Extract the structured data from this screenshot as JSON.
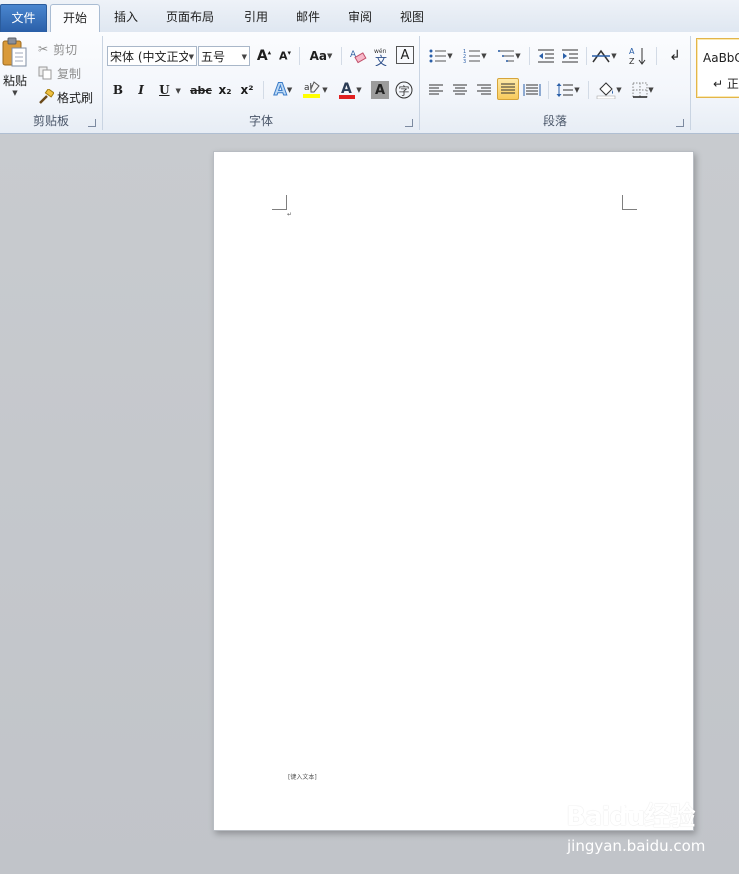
{
  "tabs": {
    "file": "文件",
    "home": "开始",
    "insert": "插入",
    "layout": "页面布局",
    "references": "引用",
    "mailings": "邮件",
    "review": "审阅",
    "view": "视图"
  },
  "clipboard": {
    "paste": "粘贴",
    "cut": "剪切",
    "copy": "复制",
    "format_painter": "格式刷",
    "group_label": "剪贴板"
  },
  "font": {
    "font_name": "宋体 (中文正文",
    "font_size": "五号",
    "change_case": "Aa",
    "bold": "B",
    "italic": "I",
    "underline": "U",
    "strikethrough": "abc",
    "subscript": "x₂",
    "superscript": "x²",
    "group_label": "字体",
    "font_color": "#e02020",
    "highlight_color": "#ffff00"
  },
  "paragraph": {
    "group_label": "段落"
  },
  "styles": {
    "preview": "AaBbC",
    "normal": "↵ 正"
  },
  "document": {
    "footer_placeholder": "[键入文本]",
    "paragraph_mark": "↵"
  },
  "watermark": {
    "brand": "Baidu经验",
    "url": "jingyan.baidu.com"
  }
}
